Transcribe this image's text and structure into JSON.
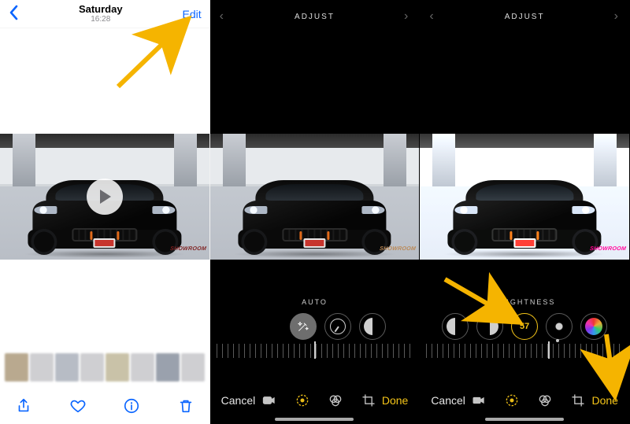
{
  "colors": {
    "ios_blue": "#0a65ff",
    "accent_yellow": "#f5c518"
  },
  "screen1": {
    "nav": {
      "title_day": "Saturday",
      "title_time": "16:28",
      "edit": "Edit"
    }
  },
  "screen2": {
    "topbar_title": "ADJUST",
    "mode_label": "AUTO",
    "cancel": "Cancel",
    "done": "Done"
  },
  "screen3": {
    "topbar_title": "ADJUST",
    "mode_label": "BRIGHTNESS",
    "brightness_value": "57",
    "cancel": "Cancel",
    "done": "Done"
  }
}
